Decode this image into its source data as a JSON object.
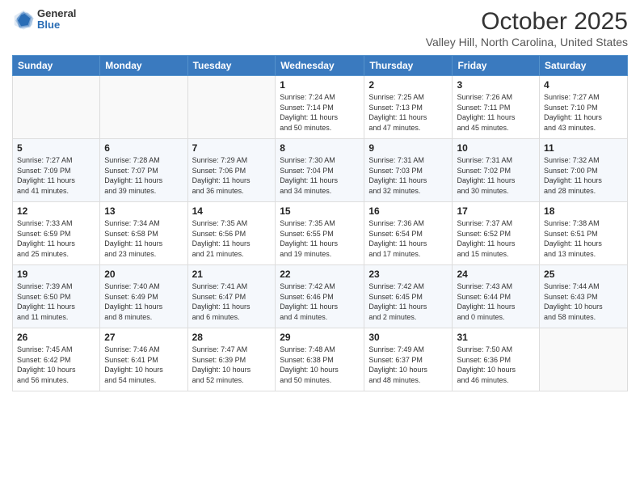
{
  "logo": {
    "general": "General",
    "blue": "Blue"
  },
  "title": "October 2025",
  "location": "Valley Hill, North Carolina, United States",
  "days_of_week": [
    "Sunday",
    "Monday",
    "Tuesday",
    "Wednesday",
    "Thursday",
    "Friday",
    "Saturday"
  ],
  "weeks": [
    [
      {
        "day": "",
        "info": ""
      },
      {
        "day": "",
        "info": ""
      },
      {
        "day": "",
        "info": ""
      },
      {
        "day": "1",
        "info": "Sunrise: 7:24 AM\nSunset: 7:14 PM\nDaylight: 11 hours\nand 50 minutes."
      },
      {
        "day": "2",
        "info": "Sunrise: 7:25 AM\nSunset: 7:13 PM\nDaylight: 11 hours\nand 47 minutes."
      },
      {
        "day": "3",
        "info": "Sunrise: 7:26 AM\nSunset: 7:11 PM\nDaylight: 11 hours\nand 45 minutes."
      },
      {
        "day": "4",
        "info": "Sunrise: 7:27 AM\nSunset: 7:10 PM\nDaylight: 11 hours\nand 43 minutes."
      }
    ],
    [
      {
        "day": "5",
        "info": "Sunrise: 7:27 AM\nSunset: 7:09 PM\nDaylight: 11 hours\nand 41 minutes."
      },
      {
        "day": "6",
        "info": "Sunrise: 7:28 AM\nSunset: 7:07 PM\nDaylight: 11 hours\nand 39 minutes."
      },
      {
        "day": "7",
        "info": "Sunrise: 7:29 AM\nSunset: 7:06 PM\nDaylight: 11 hours\nand 36 minutes."
      },
      {
        "day": "8",
        "info": "Sunrise: 7:30 AM\nSunset: 7:04 PM\nDaylight: 11 hours\nand 34 minutes."
      },
      {
        "day": "9",
        "info": "Sunrise: 7:31 AM\nSunset: 7:03 PM\nDaylight: 11 hours\nand 32 minutes."
      },
      {
        "day": "10",
        "info": "Sunrise: 7:31 AM\nSunset: 7:02 PM\nDaylight: 11 hours\nand 30 minutes."
      },
      {
        "day": "11",
        "info": "Sunrise: 7:32 AM\nSunset: 7:00 PM\nDaylight: 11 hours\nand 28 minutes."
      }
    ],
    [
      {
        "day": "12",
        "info": "Sunrise: 7:33 AM\nSunset: 6:59 PM\nDaylight: 11 hours\nand 25 minutes."
      },
      {
        "day": "13",
        "info": "Sunrise: 7:34 AM\nSunset: 6:58 PM\nDaylight: 11 hours\nand 23 minutes."
      },
      {
        "day": "14",
        "info": "Sunrise: 7:35 AM\nSunset: 6:56 PM\nDaylight: 11 hours\nand 21 minutes."
      },
      {
        "day": "15",
        "info": "Sunrise: 7:35 AM\nSunset: 6:55 PM\nDaylight: 11 hours\nand 19 minutes."
      },
      {
        "day": "16",
        "info": "Sunrise: 7:36 AM\nSunset: 6:54 PM\nDaylight: 11 hours\nand 17 minutes."
      },
      {
        "day": "17",
        "info": "Sunrise: 7:37 AM\nSunset: 6:52 PM\nDaylight: 11 hours\nand 15 minutes."
      },
      {
        "day": "18",
        "info": "Sunrise: 7:38 AM\nSunset: 6:51 PM\nDaylight: 11 hours\nand 13 minutes."
      }
    ],
    [
      {
        "day": "19",
        "info": "Sunrise: 7:39 AM\nSunset: 6:50 PM\nDaylight: 11 hours\nand 11 minutes."
      },
      {
        "day": "20",
        "info": "Sunrise: 7:40 AM\nSunset: 6:49 PM\nDaylight: 11 hours\nand 8 minutes."
      },
      {
        "day": "21",
        "info": "Sunrise: 7:41 AM\nSunset: 6:47 PM\nDaylight: 11 hours\nand 6 minutes."
      },
      {
        "day": "22",
        "info": "Sunrise: 7:42 AM\nSunset: 6:46 PM\nDaylight: 11 hours\nand 4 minutes."
      },
      {
        "day": "23",
        "info": "Sunrise: 7:42 AM\nSunset: 6:45 PM\nDaylight: 11 hours\nand 2 minutes."
      },
      {
        "day": "24",
        "info": "Sunrise: 7:43 AM\nSunset: 6:44 PM\nDaylight: 11 hours\nand 0 minutes."
      },
      {
        "day": "25",
        "info": "Sunrise: 7:44 AM\nSunset: 6:43 PM\nDaylight: 10 hours\nand 58 minutes."
      }
    ],
    [
      {
        "day": "26",
        "info": "Sunrise: 7:45 AM\nSunset: 6:42 PM\nDaylight: 10 hours\nand 56 minutes."
      },
      {
        "day": "27",
        "info": "Sunrise: 7:46 AM\nSunset: 6:41 PM\nDaylight: 10 hours\nand 54 minutes."
      },
      {
        "day": "28",
        "info": "Sunrise: 7:47 AM\nSunset: 6:39 PM\nDaylight: 10 hours\nand 52 minutes."
      },
      {
        "day": "29",
        "info": "Sunrise: 7:48 AM\nSunset: 6:38 PM\nDaylight: 10 hours\nand 50 minutes."
      },
      {
        "day": "30",
        "info": "Sunrise: 7:49 AM\nSunset: 6:37 PM\nDaylight: 10 hours\nand 48 minutes."
      },
      {
        "day": "31",
        "info": "Sunrise: 7:50 AM\nSunset: 6:36 PM\nDaylight: 10 hours\nand 46 minutes."
      },
      {
        "day": "",
        "info": ""
      }
    ]
  ],
  "colors": {
    "header_bg": "#3a7abf",
    "header_text": "#ffffff",
    "row_even": "#f5f8fc",
    "row_odd": "#ffffff"
  }
}
